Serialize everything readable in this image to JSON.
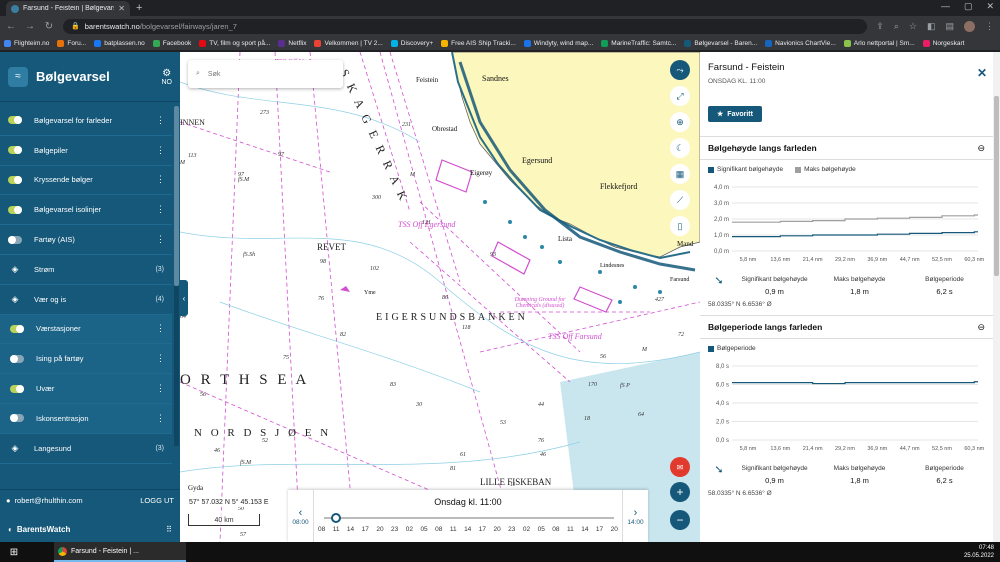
{
  "browser": {
    "tab_title": "Farsund - Feistein | Bølgevarsel",
    "url_host": "barentswatch.no",
    "url_path": "/bolgevarsel/fairways/jaren_7",
    "bookmarks": [
      "Flighteim.no",
      "Foru...",
      "batplassen.no",
      "Facebook",
      "TV, film og sport på...",
      "Netflix",
      "Velkommen | TV 2...",
      "Discovery+",
      "Free AIS Ship Tracki...",
      "Windyty, wind map...",
      "MarineTraffic: Samtc...",
      "Bølgevarsel - Baren...",
      "Navionics ChartVie...",
      "Arlo nettportal | Sm...",
      "Norgeskart"
    ]
  },
  "sidebar": {
    "title": "Bølgevarsel",
    "lang": "NO",
    "items": [
      {
        "label": "Bølgevarsel for farleder",
        "kind": "toggle",
        "on": true,
        "sub": false
      },
      {
        "label": "Bølgepiler",
        "kind": "toggle",
        "on": true,
        "sub": false
      },
      {
        "label": "Kryssende bølger",
        "kind": "toggle",
        "on": true,
        "sub": false
      },
      {
        "label": "Bølgevarsel isolinjer",
        "kind": "toggle",
        "on": true,
        "sub": false
      },
      {
        "label": "Fartøy (AIS)",
        "kind": "toggle",
        "on": false,
        "sub": false
      },
      {
        "label": "Strøm",
        "kind": "group",
        "count": "(3)"
      },
      {
        "label": "Vær og is",
        "kind": "group",
        "count": "(4)"
      },
      {
        "label": "Værstasjoner",
        "kind": "toggle",
        "on": true,
        "sub": true
      },
      {
        "label": "Ising på fartøy",
        "kind": "toggle",
        "on": false,
        "sub": true
      },
      {
        "label": "Uvær",
        "kind": "toggle",
        "on": true,
        "sub": true
      },
      {
        "label": "Iskonsentrasjon",
        "kind": "toggle",
        "on": false,
        "sub": true
      },
      {
        "label": "Langesund",
        "kind": "group",
        "count": "(3)"
      }
    ],
    "user": "robert@rhulthin.com",
    "logout": "LOGG UT",
    "brand": "BarentsWatch"
  },
  "map": {
    "search_placeholder": "Søk",
    "coords": "57° 57.032 N 5° 45.153 E",
    "scale": "40 km",
    "labels": {
      "sandnes": "Sandnes",
      "feistein": "Feistein",
      "obrestad": "Obrestad",
      "egersund": "Egersund",
      "eigeroy": "Eigerøy",
      "flekkefjord": "Flekkefjord",
      "lista": "Lista",
      "lindesnes": "Lindesnes",
      "mandal": "Mand",
      "farsund": "Farsund",
      "tss_egersund": "TSS Off Egersund",
      "tss_farsund": "TSS Off Farsund",
      "tss_utsira": "TSS Off Utsira",
      "dumping": "Dumping Ground for Chemicals (disused)",
      "revet": "REVET",
      "eigersundsbanken": "EIGERSUNDSBANKEN",
      "north_sea": "O R T H   S E A",
      "nordsjoen": "N O R D S J Ø E N",
      "lille_fiskebank": "LILLE FISKEBAN",
      "skagerrak": "S K A G E R R A K",
      "innen": "INNEN",
      "gyda": "Gyda",
      "yme": "Yme"
    },
    "depths": [
      "273",
      "97",
      "113",
      "M",
      "M",
      "97",
      "231",
      "300",
      "121",
      "fS.M",
      "fS.Sh",
      "98",
      "102",
      "86",
      "64",
      "76",
      "82",
      "118",
      "75",
      "56",
      "52",
      "61",
      "40",
      "53",
      "46",
      "170",
      "fS P",
      "M",
      "72",
      "44",
      "fS.M",
      "57",
      "427",
      "76",
      "30",
      "35",
      "18",
      "11",
      "50",
      "46",
      "81",
      "93",
      "56",
      "64",
      "83"
    ]
  },
  "timeline": {
    "title": "Onsdag kl. 11:00",
    "prev_time": "08:00",
    "next_time": "14:00",
    "hours": [
      "08",
      "11",
      "14",
      "17",
      "20",
      "23",
      "02",
      "05",
      "08",
      "11",
      "14",
      "17",
      "20",
      "23",
      "02",
      "05",
      "08",
      "11",
      "14",
      "17",
      "20"
    ],
    "position": 0.04
  },
  "panel": {
    "title": "Farsund - Feistein",
    "subtitle": "ONSDAG KL. 11:00",
    "favorite": "Favoritt",
    "wave_height": {
      "title": "Bølgehøyde langs farleden",
      "legend": [
        "Signifikant bølgehøyde",
        "Maks bølgehøyde"
      ],
      "chart_data": {
        "type": "line",
        "x": [
          "5,8 nm",
          "13,6 nm",
          "21,4 nm",
          "29,2 nm",
          "36,9 nm",
          "44,7 nm",
          "52,5 nm",
          "60,3 nm"
        ],
        "yticks": [
          "4,0 m",
          "3,0 m",
          "2,0 m",
          "1,0 m",
          "0,0 m"
        ],
        "ylim": [
          0,
          4
        ],
        "series": [
          {
            "name": "Signifikant bølgehøyde",
            "values": [
              0.9,
              0.95,
              1.0,
              1.0,
              1.05,
              1.1,
              1.15,
              1.2
            ]
          },
          {
            "name": "Maks bølgehøyde",
            "values": [
              1.8,
              1.85,
              1.9,
              2.0,
              2.05,
              2.1,
              2.2,
              2.25
            ]
          }
        ],
        "colors": [
          "#15587a",
          "#9e9e9e"
        ]
      },
      "stats": [
        {
          "label": "Signifikant bølgehøyde",
          "value": "0,9 m"
        },
        {
          "label": "Maks bølgehøyde",
          "value": "1,8 m"
        },
        {
          "label": "Bølgeperiode",
          "value": "6,2 s"
        }
      ],
      "coords": "58.0335° N 6.6536° Ø"
    },
    "wave_period": {
      "title": "Bølgeperiode langs farleden",
      "legend": [
        "Bølgeperiode"
      ],
      "chart_data": {
        "type": "line",
        "x": [
          "5,8 nm",
          "13,6 nm",
          "21,4 nm",
          "29,2 nm",
          "36,9 nm",
          "44,7 nm",
          "52,5 nm",
          "60,3 nm"
        ],
        "yticks": [
          "8,0 s",
          "6,0 s",
          "4,0 s",
          "2,0 s",
          "0,0 s"
        ],
        "ylim": [
          0,
          8
        ],
        "series": [
          {
            "name": "Bølgeperiode",
            "values": [
              6.2,
              6.2,
              6.1,
              6.2,
              6.2,
              6.2,
              6.2,
              6.3
            ]
          }
        ],
        "colors": [
          "#15587a"
        ]
      },
      "stats": [
        {
          "label": "Signifikant bølgehøyde",
          "value": "0,9 m"
        },
        {
          "label": "Maks bølgehøyde",
          "value": "1,8 m"
        },
        {
          "label": "Bølgeperiode",
          "value": "6,2 s"
        }
      ],
      "coords": "58.0335° N 6.6536° Ø"
    }
  },
  "taskbar": {
    "app_label": "Farsund - Feistein | ...",
    "time": "07:48",
    "date": "25.05.2022"
  }
}
